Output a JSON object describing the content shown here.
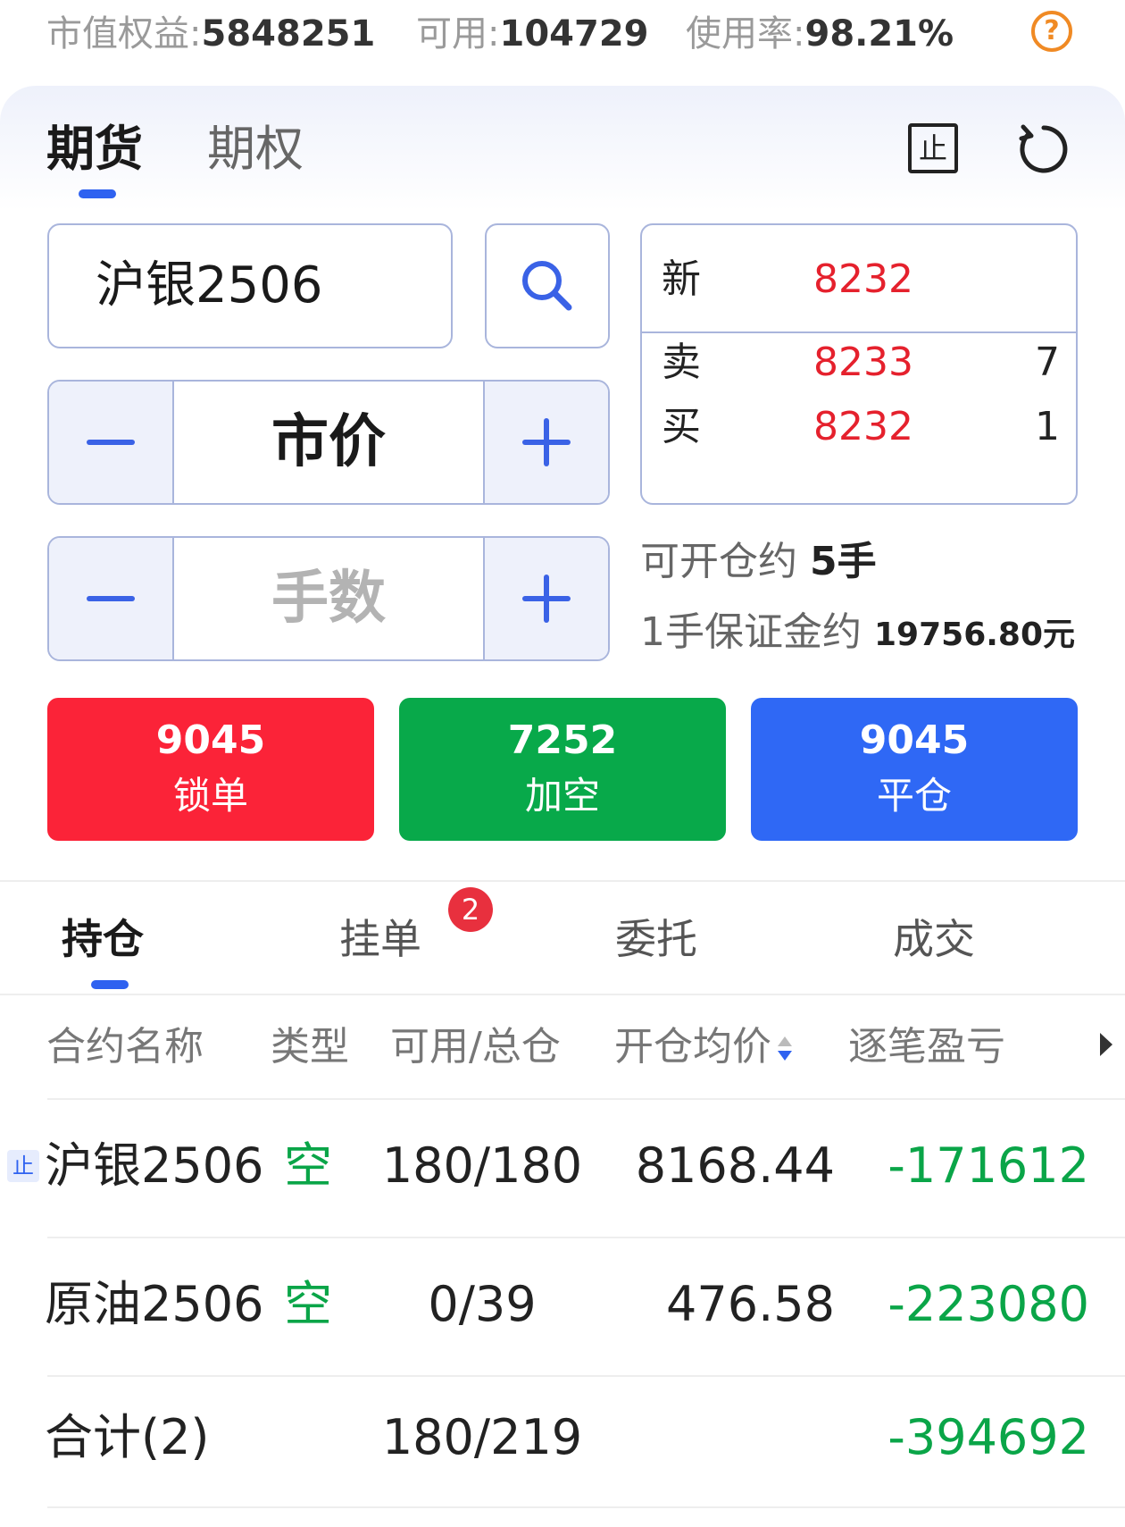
{
  "account": {
    "equity_label": "市值权益:",
    "equity_value": "5848251",
    "available_label": "可用:",
    "available_value": "104729",
    "usage_label": "使用率:",
    "usage_value": "98.21%",
    "help_glyph": "?"
  },
  "order_panel": {
    "tabs": [
      {
        "label": "期货",
        "active": true
      },
      {
        "label": "期权",
        "active": false
      }
    ],
    "stop_icon_glyph": "止",
    "symbol": "沪银2506",
    "price_mode": "市价",
    "quantity_placeholder": "手数",
    "quote": {
      "last_label": "新",
      "last_price": "8232",
      "ask_label": "卖",
      "ask_price": "8233",
      "ask_volume": "7",
      "bid_label": "买",
      "bid_price": "8232",
      "bid_volume": "1"
    },
    "openable_label": "可开仓约",
    "openable_value": "5手",
    "margin_label": "1手保证金约",
    "margin_value": "19756.80元",
    "actions": [
      {
        "number": "9045",
        "label": "锁单",
        "color": "#fb2338"
      },
      {
        "number": "7252",
        "label": "加空",
        "color": "#08a94a"
      },
      {
        "number": "9045",
        "label": "平仓",
        "color": "#2f68f5"
      }
    ]
  },
  "list_tabs": [
    {
      "label": "持仓",
      "active": true
    },
    {
      "label": "挂单",
      "badge": "2"
    },
    {
      "label": "委托"
    },
    {
      "label": "成交"
    }
  ],
  "positions": {
    "headers": [
      "合约名称",
      "类型",
      "可用/总仓",
      "开仓均价",
      "逐笔盈亏"
    ],
    "rows": [
      {
        "stop_tag": "止",
        "name": "沪银2506",
        "type": "空",
        "avail_total": "180/180",
        "avg_price": "8168.44",
        "pnl": "-171612"
      },
      {
        "name": "原油2506",
        "type": "空",
        "avail_total": "0/39",
        "avg_price": "476.58",
        "pnl": "-223080"
      }
    ],
    "total": {
      "name": "合计(2)",
      "avail_total": "180/219",
      "pnl": "-394692"
    }
  },
  "colors": {
    "accent": "#2f62f0",
    "up": "#e5212d",
    "down": "#0aa548"
  }
}
